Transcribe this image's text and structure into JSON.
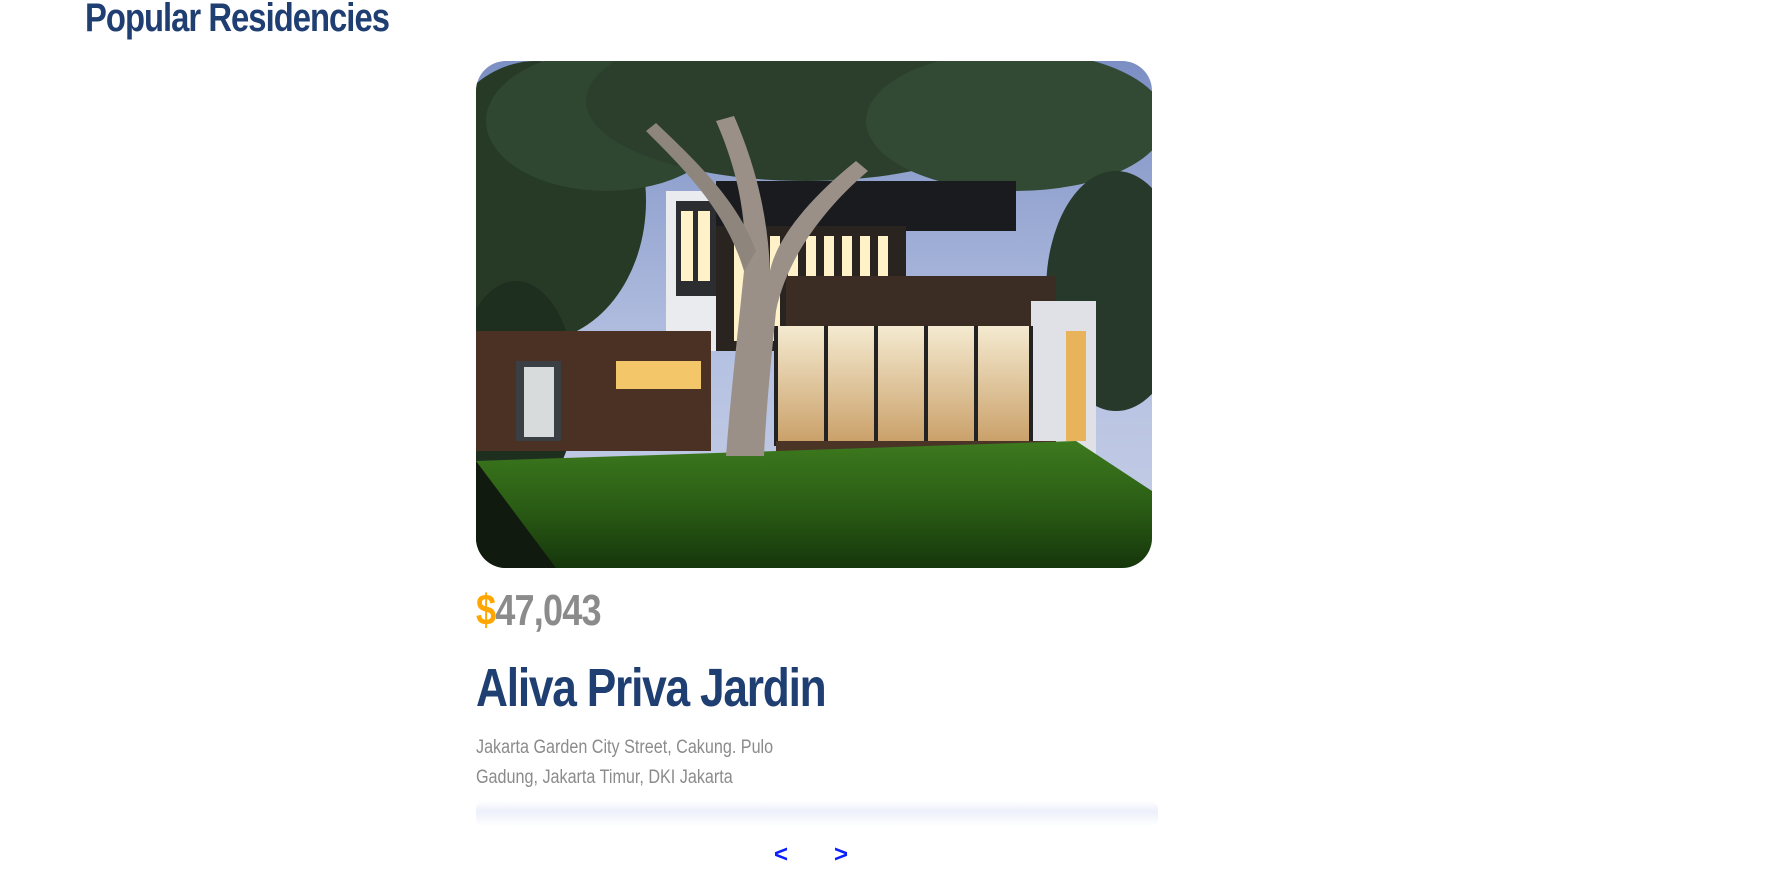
{
  "section": {
    "title": "Popular Residencies"
  },
  "residency": {
    "currency_symbol": "$",
    "price": "47,043",
    "name": "Aliva Priva Jardin",
    "address": "Jakarta Garden City Street, Cakung. Pulo Gadung, Jakarta Timur, DKI Jakarta",
    "image": "modern-house-photo"
  },
  "navigation": {
    "prev_label": "<",
    "next_label": ">"
  },
  "colors": {
    "title": "#1f3e72",
    "price": "#8c8b8b",
    "currency": "#ffa600",
    "nav_arrows": "#0a1fff"
  }
}
